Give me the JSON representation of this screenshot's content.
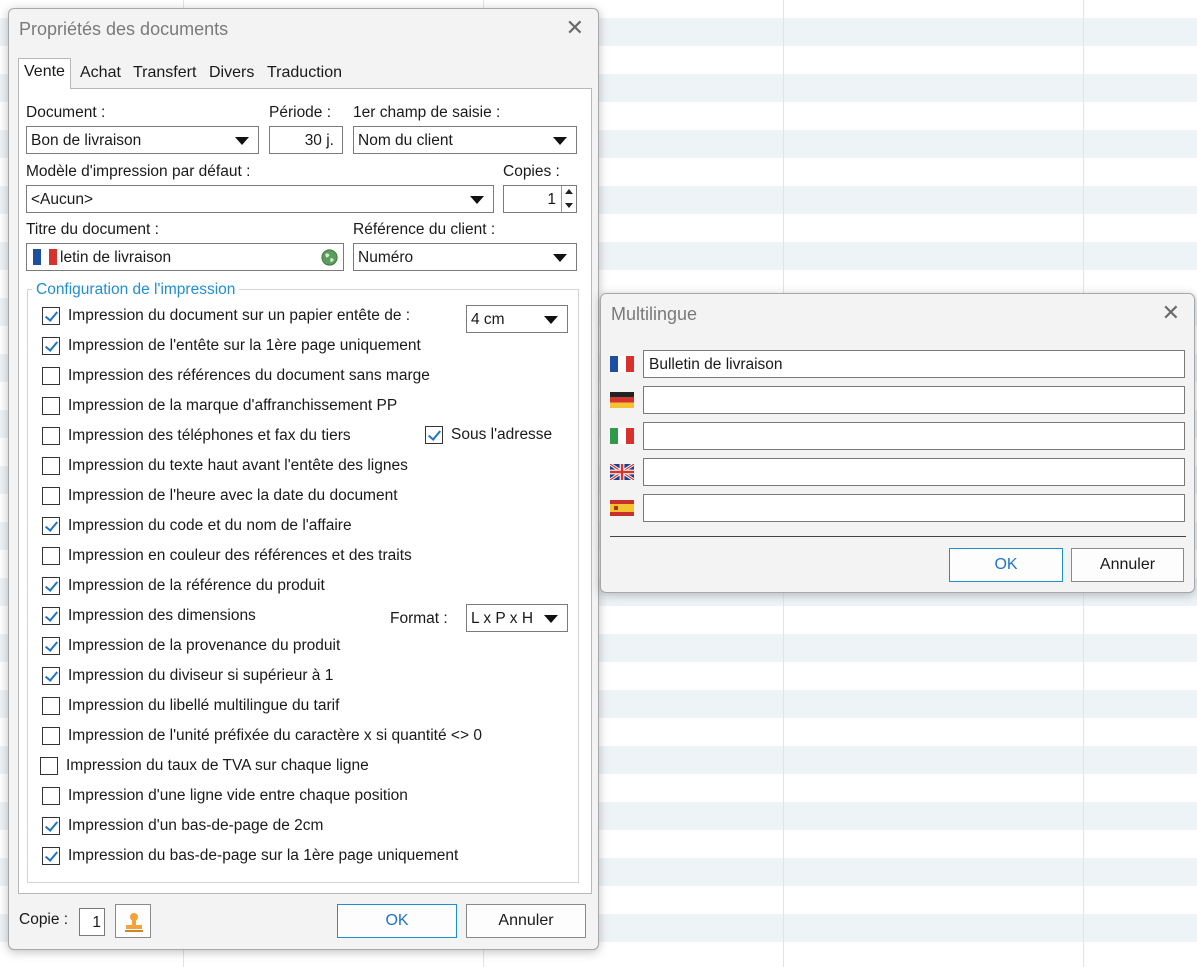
{
  "main_dialog": {
    "title": "Propriétés des documents",
    "tabs": [
      "Vente",
      "Achat",
      "Transfert",
      "Divers",
      "Traduction"
    ],
    "document_label": "Document :",
    "document_value": "Bon de livraison",
    "periode_label": "Période :",
    "periode_value": "30 j.",
    "premier_champ_label": "1er champ de saisie :",
    "premier_champ_value": "Nom du client",
    "modele_label": "Modèle d'impression par défaut :",
    "modele_value": "<Aucun>",
    "copies_label": "Copies :",
    "copies_value": "1",
    "titre_label": "Titre du document :",
    "titre_value": "letin de livraison",
    "reference_label": "Référence du client :",
    "reference_value": "Numéro",
    "group_title": "Configuration de l'impression",
    "entete_size": "4 cm",
    "sous_adresse_label": "Sous l'adresse",
    "sous_adresse_checked": true,
    "format_label": "Format :",
    "format_value": "L x P x H",
    "options": [
      {
        "label": "Impression du document sur un papier entête de :",
        "checked": true
      },
      {
        "label": "Impression de l'entête sur la 1ère page uniquement",
        "checked": true
      },
      {
        "label": "Impression des références du document sans marge",
        "checked": false
      },
      {
        "label": "Impression de la marque d'affranchissement PP",
        "checked": false
      },
      {
        "label": "Impression des téléphones et fax du tiers",
        "checked": false
      },
      {
        "label": "Impression du texte haut avant l'entête des lignes",
        "checked": false
      },
      {
        "label": "Impression de l'heure avec la date du document",
        "checked": false
      },
      {
        "label": "Impression du code et du nom de l'affaire",
        "checked": true
      },
      {
        "label": "Impression en couleur des références et des traits",
        "checked": false
      },
      {
        "label": "Impression de la référence du produit",
        "checked": true
      },
      {
        "label": "Impression des dimensions",
        "checked": true
      },
      {
        "label": "Impression de la provenance du produit",
        "checked": true
      },
      {
        "label": "Impression du diviseur si supérieur à 1",
        "checked": true
      },
      {
        "label": "Impression du libellé multilingue du tarif",
        "checked": false
      },
      {
        "label": "Impression de l'unité préfixée du caractère x si quantité <> 0",
        "checked": false
      },
      {
        "label": "Impression du taux de TVA sur chaque ligne",
        "checked": false
      },
      {
        "label": "Impression d'une ligne vide entre chaque position",
        "checked": false
      },
      {
        "label": "Impression d'un bas-de-page de 2cm",
        "checked": true
      },
      {
        "label": "Impression du bas-de-page sur la 1ère page uniquement",
        "checked": true
      }
    ],
    "copie_label": "Copie :",
    "copie_value": "1",
    "ok_label": "OK",
    "cancel_label": "Annuler"
  },
  "multilingue_dialog": {
    "title": "Multilingue",
    "rows": [
      {
        "flag": "flag-fr-icon",
        "value": "Bulletin de livraison"
      },
      {
        "flag": "flag-de-icon",
        "value": ""
      },
      {
        "flag": "flag-it-icon",
        "value": ""
      },
      {
        "flag": "flag-gb-icon",
        "value": ""
      },
      {
        "flag": "flag-es-icon",
        "value": ""
      }
    ],
    "ok_label": "OK",
    "cancel_label": "Annuler"
  },
  "colors": {
    "accent": "#1f8fd1",
    "check": "#1f74c8",
    "stripe": "#eef3f8"
  }
}
